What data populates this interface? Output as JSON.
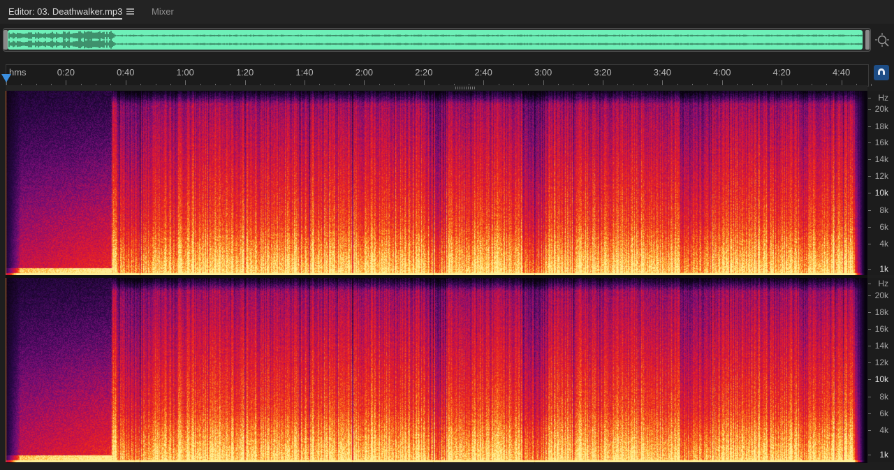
{
  "tabs": {
    "editor_label": "Editor: 03. Deathwalker.mp3",
    "mixer_label": "Mixer"
  },
  "overview": {
    "waveform_color": "#6ef0b8",
    "view_range_fraction": [
      0.0,
      1.0
    ]
  },
  "ruler": {
    "unit": "hms",
    "labels": [
      "0:20",
      "0:40",
      "1:00",
      "1:20",
      "1:40",
      "2:00",
      "2:20",
      "2:40",
      "3:00",
      "3:20",
      "3:40",
      "4:00",
      "4:20",
      "4:40"
    ]
  },
  "freq_scale": {
    "unit": "Hz",
    "labels": [
      "20k",
      "18k",
      "16k",
      "14k",
      "12k",
      "10k",
      "8k",
      "6k",
      "4k",
      "1k"
    ]
  },
  "icons": {
    "zoom": "zoom-to-fit-icon",
    "snap": "magnet-snap-icon",
    "playhead": "playhead-marker-icon",
    "menu": "hamburger-menu-icon"
  },
  "colors": {
    "spectrum_low": "#0a0410",
    "spectrum_mid": "#7a0d8a",
    "spectrum_high": "#e8281c",
    "spectrum_peak": "#ffe27a",
    "accent": "#3b8fe0"
  }
}
